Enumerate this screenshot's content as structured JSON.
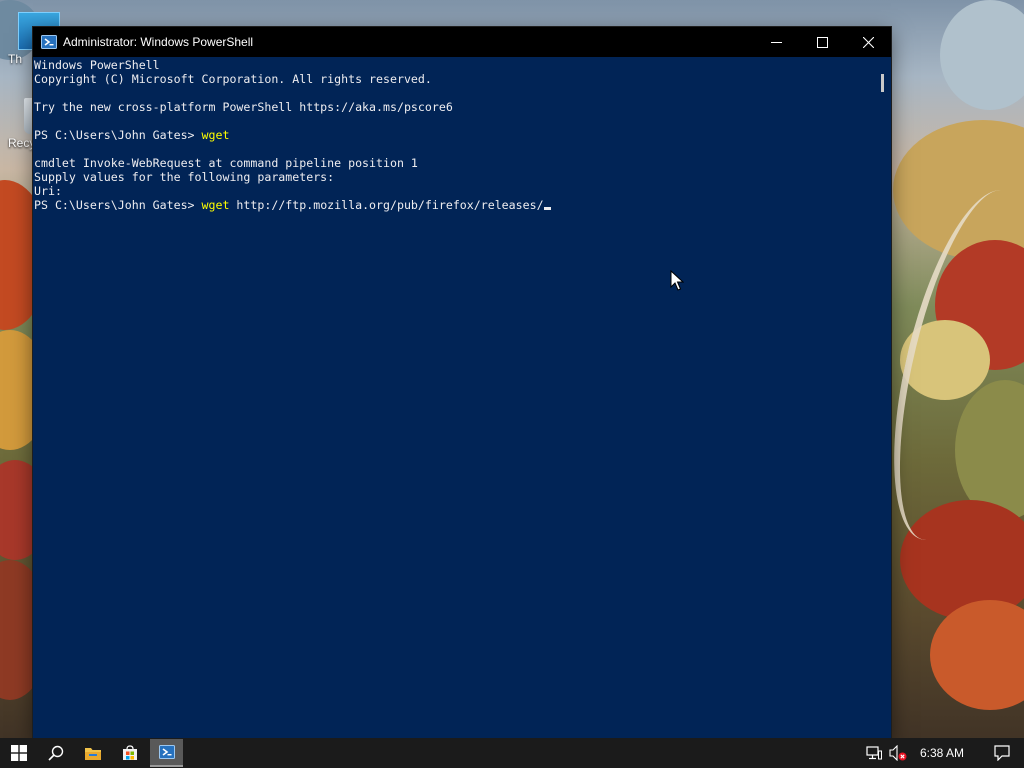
{
  "window": {
    "title": "Administrator: Windows PowerShell",
    "title_icon": "powershell-icon",
    "controls": [
      "minimize-icon",
      "maximize-icon",
      "close-icon"
    ]
  },
  "console": {
    "header_line1": "Windows PowerShell",
    "header_line2": "Copyright (C) Microsoft Corporation. All rights reserved.",
    "promo_line": "Try the new cross-platform PowerShell https://aka.ms/pscore6",
    "prompt": "PS C:\\Users\\John Gates> ",
    "first_command": "wget",
    "output_line1": "cmdlet Invoke-WebRequest at command pipeline position 1",
    "output_line2": "Supply values for the following parameters:",
    "output_line3": "Uri:",
    "current_command": "wget",
    "current_argument": " http://ftp.mozilla.org/pub/firefox/releases/",
    "text_color": "#eeedf0",
    "command_color": "#ffff00",
    "background_color": "#012456"
  },
  "desktop": {
    "icons": [
      {
        "label": "Th",
        "icon": "this-pc-icon"
      },
      {
        "label": "Recy",
        "icon": "recycle-bin-icon"
      }
    ]
  },
  "taskbar": {
    "items": [
      "start-icon",
      "search-icon",
      "file-explorer-icon",
      "store-icon",
      "powershell-icon"
    ],
    "active_item": "powershell-icon",
    "tray_icons": [
      "network-icon",
      "volume-muted-icon"
    ],
    "clock": "6:38 AM",
    "notification_icon": "action-center-icon"
  }
}
